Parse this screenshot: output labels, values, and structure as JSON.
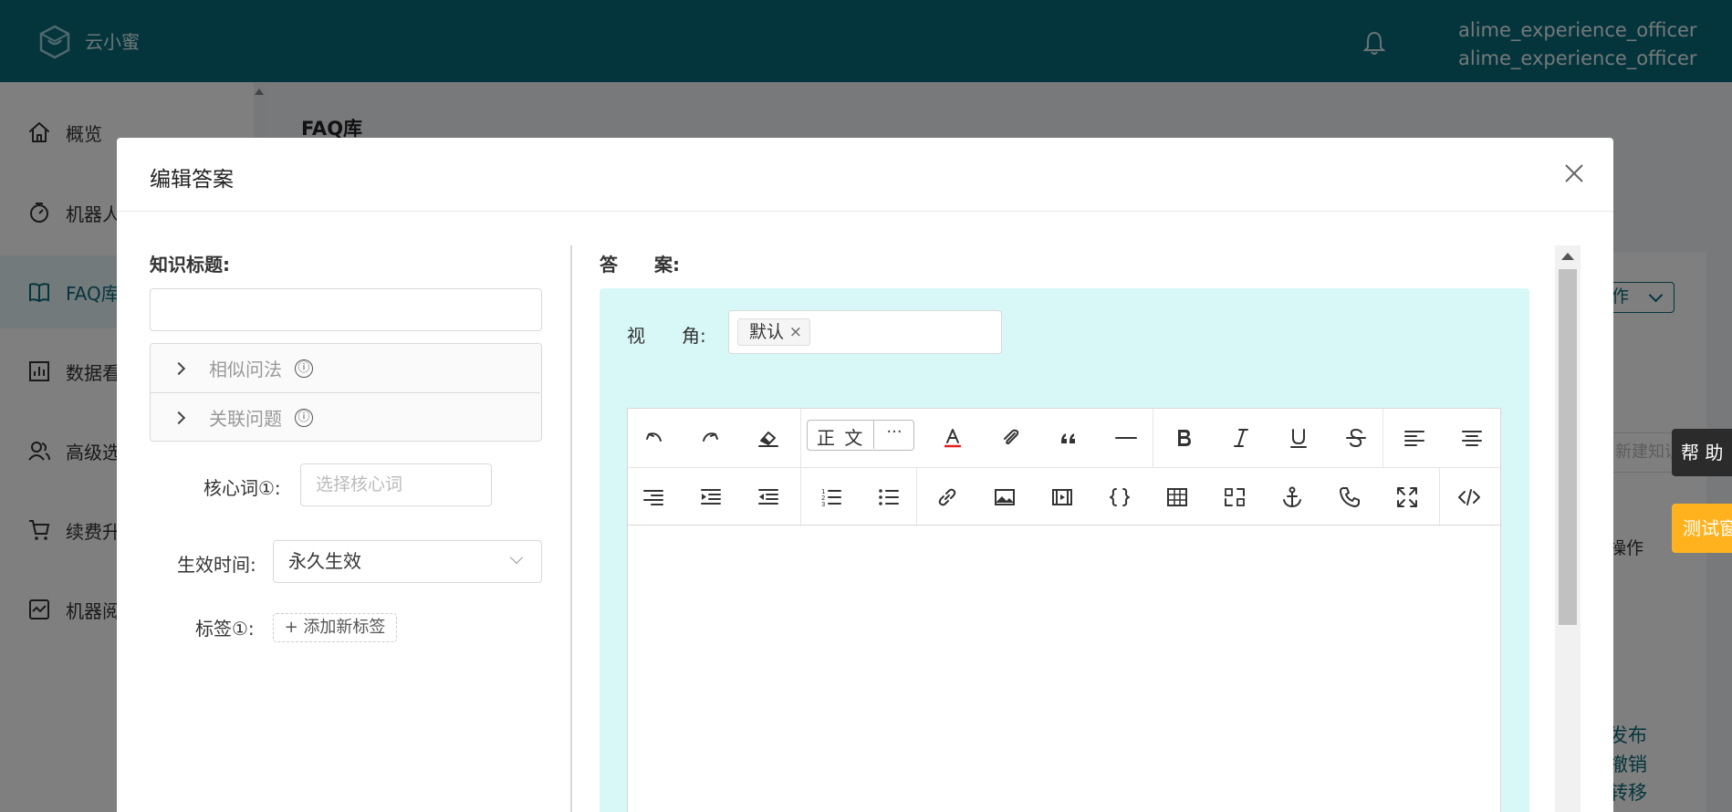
{
  "header": {
    "brand": "云小蜜",
    "user_line1": "alime_experience_officer",
    "user_line2": "alime_experience_officer"
  },
  "sidebar": {
    "items": [
      {
        "label": "概览",
        "icon": "home-icon"
      },
      {
        "label": "机器人",
        "icon": "robot-icon"
      },
      {
        "label": "FAQ库",
        "icon": "book-icon",
        "active": true
      },
      {
        "label": "数据看",
        "icon": "chart-icon"
      },
      {
        "label": "高级选",
        "icon": "users-icon"
      },
      {
        "label": "续费升",
        "icon": "cart-icon"
      },
      {
        "label": "机器阅",
        "icon": "monitor-icon"
      }
    ]
  },
  "page": {
    "title": "FAQ库",
    "batch_btn": "作",
    "search_placeholder": "新建知识",
    "op_header": "操作",
    "links": [
      "发布",
      "撤销",
      "转移"
    ],
    "help_btn": "帮 助",
    "test_btn": "测试窗"
  },
  "modal": {
    "title": "编辑答案",
    "knowledge_title_label": "知识标题:",
    "knowledge_title_value": "",
    "similar_label": "相似问法",
    "related_label": "关联问题",
    "info_glyph": "ⓘ",
    "core_word_label": "核心词①:",
    "core_word_placeholder": "选择核心词",
    "effective_label": "生效时间:",
    "effective_value": "永久生效",
    "tag_label": "标签①:",
    "add_tag": "+ 添加新标签",
    "answer_label": "答　　案:",
    "view_label": "视　　角:",
    "view_tag": "默认",
    "view_tag_remove": "×",
    "paragraph_style": "正 文",
    "more": "···",
    "accent_color": "#0a6a79",
    "answer_bg": "#d8f7f7"
  },
  "toolbar": {
    "row1": [
      "undo-icon",
      "redo-icon",
      "eraser-icon",
      "font-color-icon",
      "attachment-icon",
      "quote-icon",
      "hr-icon",
      "bold-icon",
      "italic-icon",
      "underline-icon",
      "strike-icon",
      "align-left-icon",
      "align-center-icon"
    ],
    "row2": [
      "align-right-icon",
      "indent-icon",
      "outdent-icon",
      "ordered-list-icon",
      "bullet-list-icon",
      "link-icon",
      "image-icon",
      "video-icon",
      "code-braces-icon",
      "table-icon",
      "variable-icon",
      "anchor-icon",
      "phone-icon",
      "fullscreen-icon",
      "source-code-icon"
    ]
  }
}
